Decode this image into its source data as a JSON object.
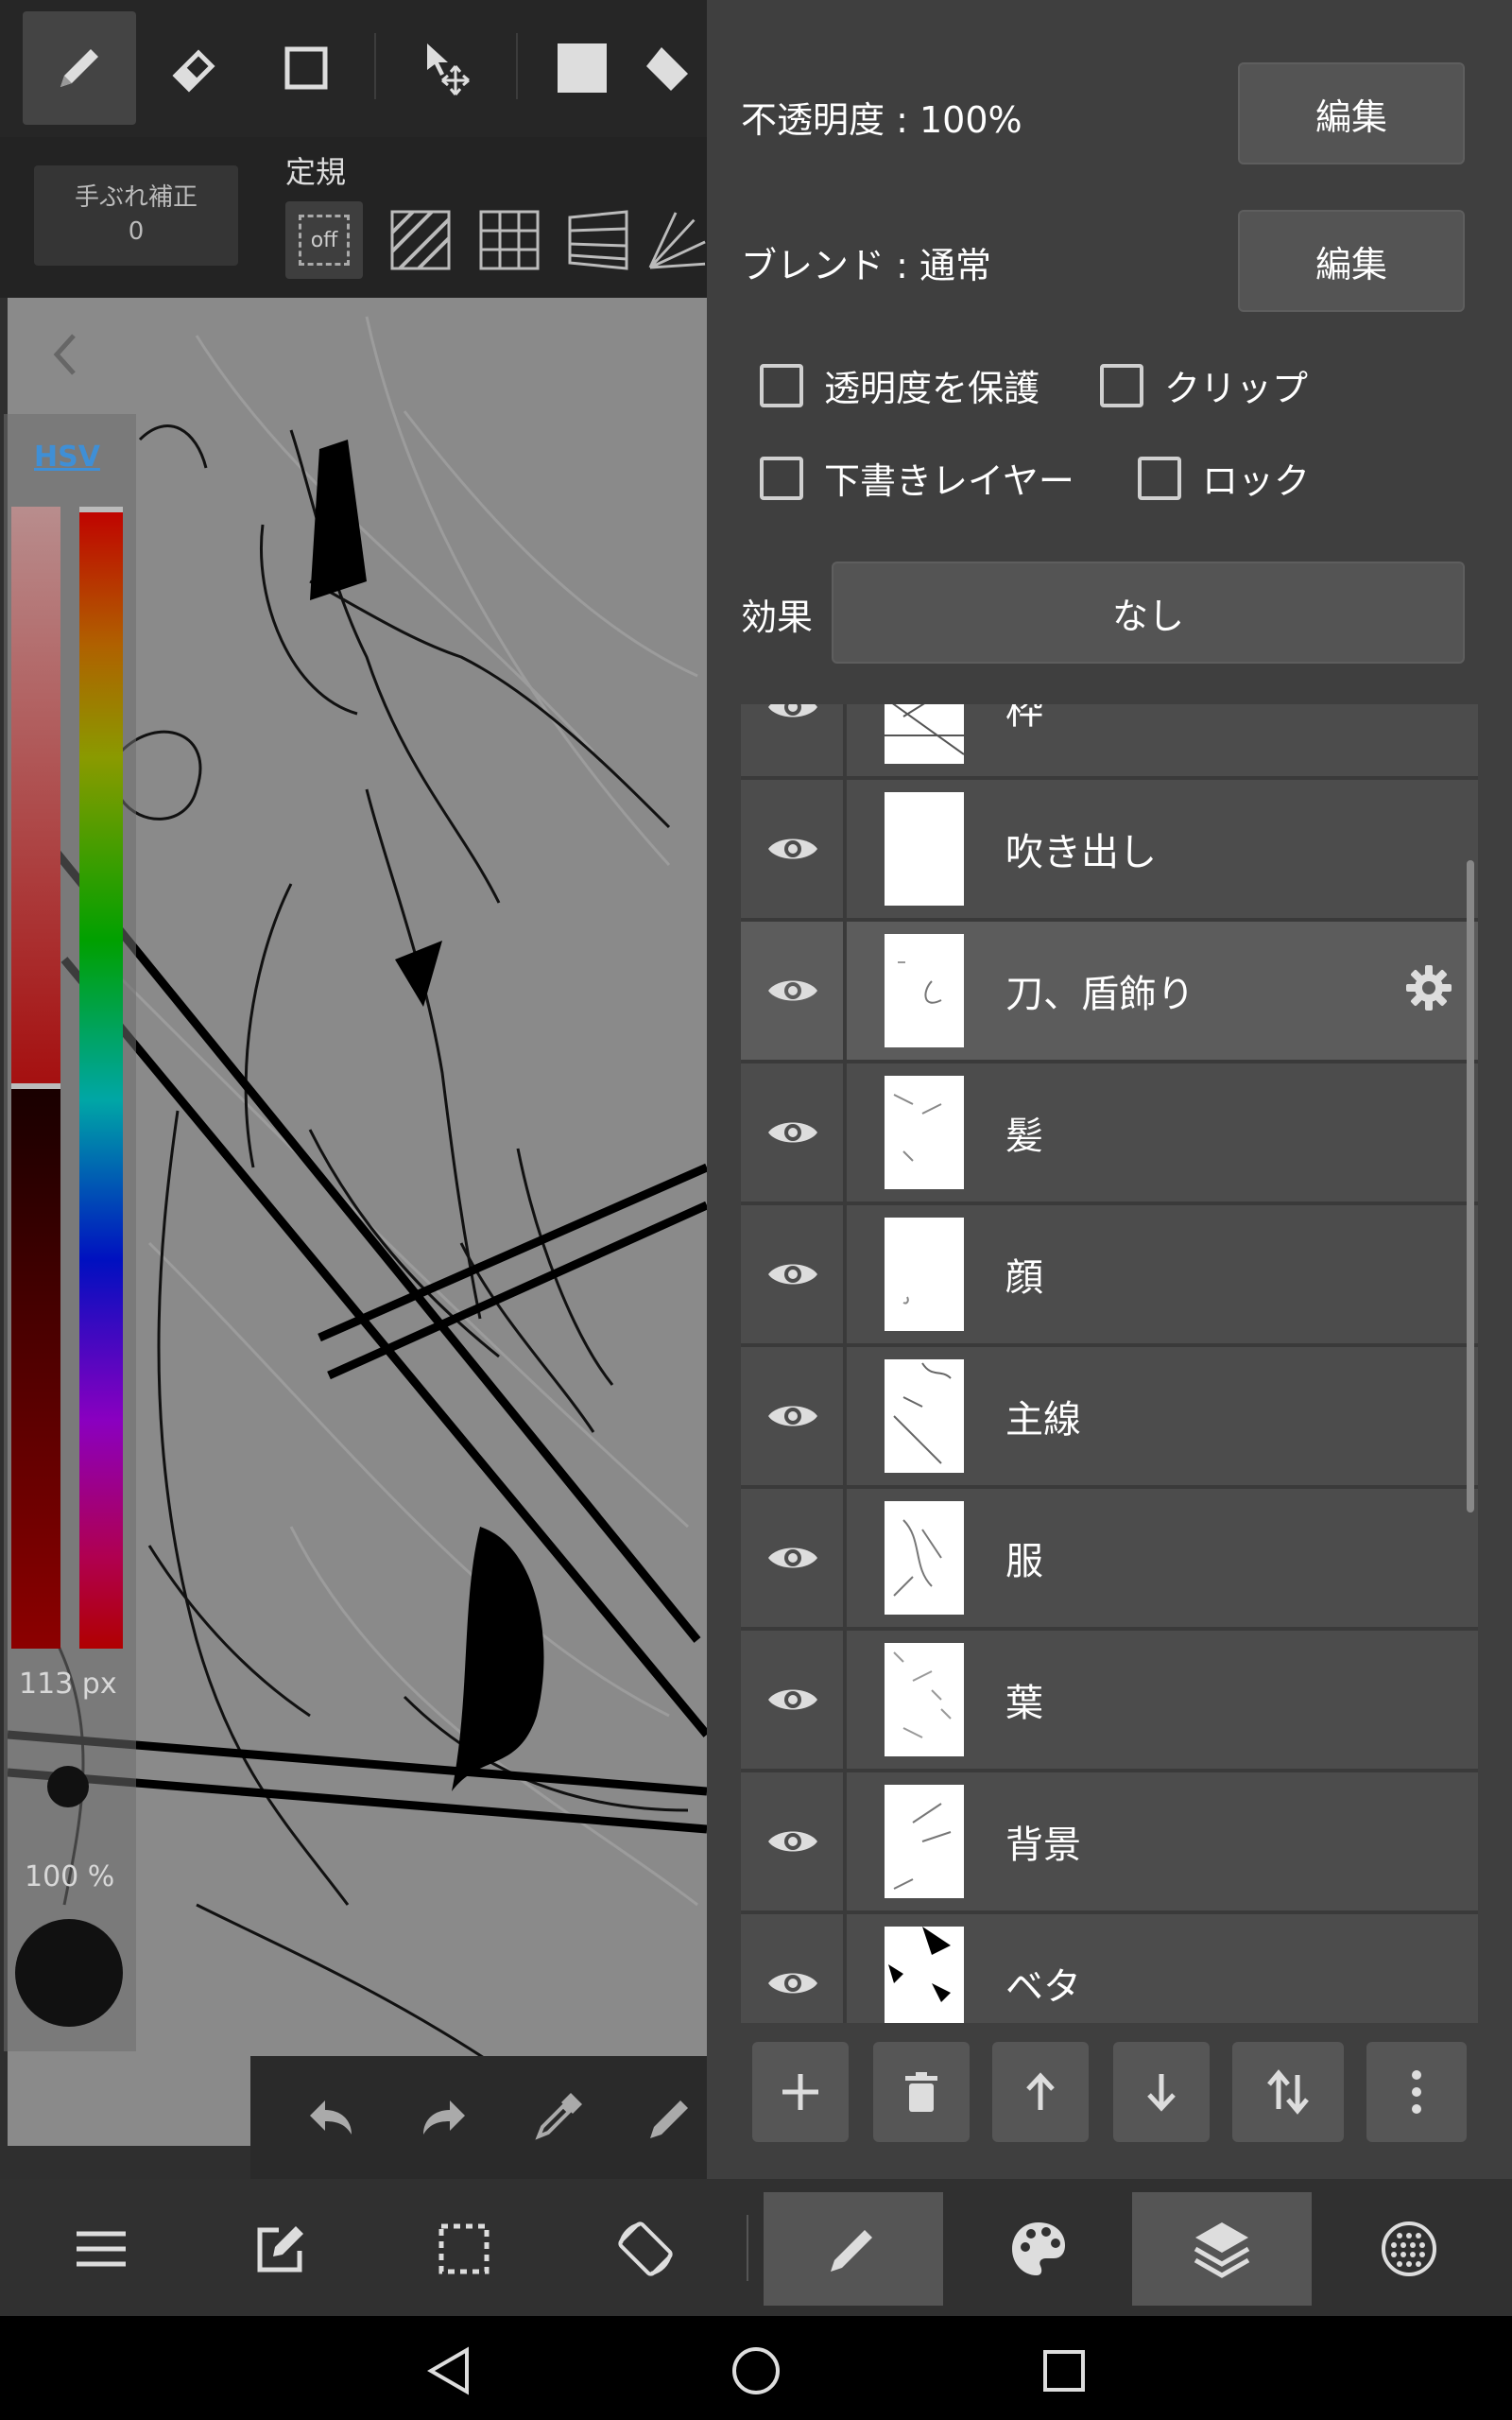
{
  "toolbar": {
    "tools": [
      "brush-icon",
      "eraser-icon",
      "rectangle-select-icon",
      "move-transform-icon",
      "fill-color-icon",
      "bucket-icon"
    ]
  },
  "stabilizer": {
    "label": "手ぶれ補正",
    "value": "0"
  },
  "ruler": {
    "title": "定規",
    "off_label": "off"
  },
  "color": {
    "mode_label": "HSV",
    "brush_size": "113 px",
    "brush_opacity": "100 %"
  },
  "layer_settings": {
    "opacity_label": "不透明度 : 100%",
    "blend_label": "ブレンド : 通常",
    "edit_button": "編集",
    "protect_alpha": "透明度を保護",
    "clip": "クリップ",
    "draft_layer": "下書きレイヤー",
    "lock": "ロック",
    "effect_label": "効果",
    "effect_value": "なし"
  },
  "layers": [
    {
      "name": "枠",
      "visible": true,
      "selected": false
    },
    {
      "name": "吹き出し",
      "visible": true,
      "selected": false
    },
    {
      "name": "刀、盾飾り",
      "visible": true,
      "selected": true
    },
    {
      "name": "髪",
      "visible": true,
      "selected": false
    },
    {
      "name": "顔",
      "visible": true,
      "selected": false
    },
    {
      "name": "主線",
      "visible": true,
      "selected": false
    },
    {
      "name": "服",
      "visible": true,
      "selected": false
    },
    {
      "name": "葉",
      "visible": true,
      "selected": false
    },
    {
      "name": "背景",
      "visible": true,
      "selected": false
    },
    {
      "name": "ベタ",
      "visible": true,
      "selected": false
    }
  ],
  "colors": {
    "panel_bg": "#3f3f3f",
    "selected_layer": "#5c5c5c",
    "hsv_link": "#3f8fd6",
    "canvas_gray": "#8a8a8a"
  }
}
